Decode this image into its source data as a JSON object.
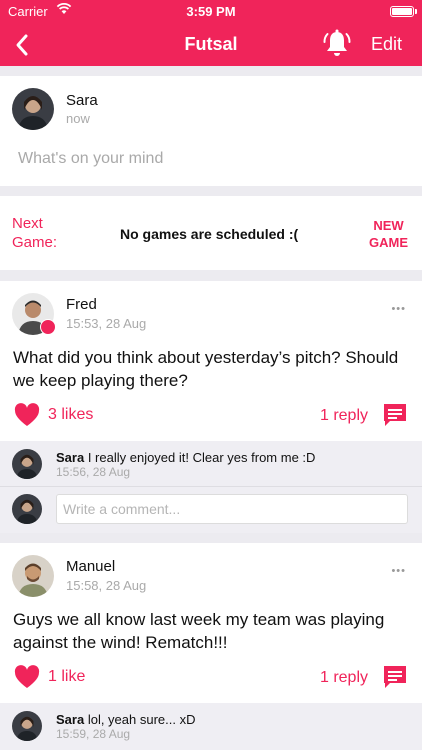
{
  "status_bar": {
    "carrier": "Carrier",
    "time": "3:59 PM",
    "battery_level": 1.0
  },
  "nav": {
    "title": "Futsal",
    "edit_label": "Edit",
    "back_icon": "chevron-left-icon",
    "bell_icon": "bell-icon"
  },
  "composer": {
    "name": "Sara",
    "time": "now",
    "placeholder": "What's on your mind"
  },
  "next_game": {
    "label_line1": "Next",
    "label_line2": "Game:",
    "message": "No games are scheduled :(",
    "new_line1": "NEW",
    "new_line2": "GAME"
  },
  "posts": [
    {
      "author": "Fred",
      "time": "15:53, 28 Aug",
      "more": "•••",
      "body": "What did you think about yesterday’s pitch? Should we keep playing there?",
      "likes": "3 likes",
      "replies": "1 reply",
      "comments": [
        {
          "author": "Sara",
          "text": "I really enjoyed it! Clear yes from me :D",
          "time": "15:56, 28 Aug"
        }
      ],
      "comment_placeholder": "Write a comment..."
    },
    {
      "author": "Manuel",
      "time": "15:58, 28 Aug",
      "more": "•••",
      "body": "Guys we all know last week my team was playing against the wind! Rematch!!!",
      "likes": "1 like",
      "replies": "1 reply",
      "comments": [
        {
          "author": "Sara",
          "text": "lol, yeah sure... xD",
          "time": "15:59, 28 Aug"
        }
      ]
    }
  ],
  "colors": {
    "accent": "#f0245a",
    "background": "#ecebf0",
    "comment_bg": "#efeef3"
  }
}
